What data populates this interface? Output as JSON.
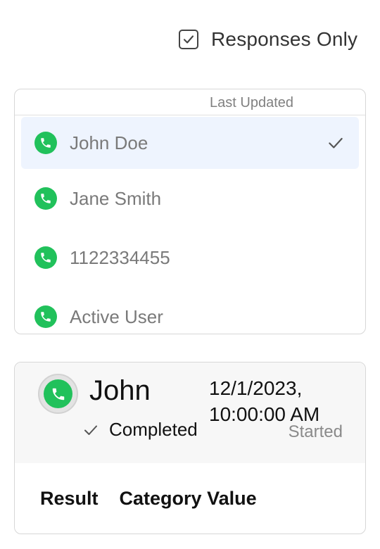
{
  "filter": {
    "responses_only_label": "Responses Only",
    "responses_only_checked": true
  },
  "list": {
    "column_header": "Last Updated",
    "items": [
      {
        "name": "John Doe",
        "icon": "phone-icon",
        "selected": true
      },
      {
        "name": "Jane Smith",
        "icon": "phone-icon",
        "selected": false
      },
      {
        "name": "1122334455",
        "icon": "phone-icon",
        "selected": false
      },
      {
        "name": "Active User",
        "icon": "phone-icon",
        "selected": false
      }
    ]
  },
  "detail": {
    "name": "John",
    "status": "Completed",
    "datetime": "12/1/2023, 10:00:00 AM",
    "datetime_caption": "Started",
    "table_headers": [
      "Result",
      "Category Value"
    ]
  },
  "colors": {
    "accent_green": "#21c15b",
    "selected_bg": "#eef4fe"
  }
}
